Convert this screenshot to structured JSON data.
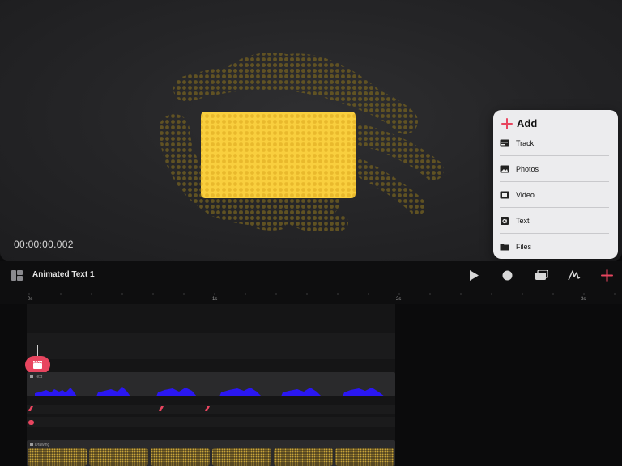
{
  "preview": {
    "timecode": "00:00:00.002"
  },
  "add_menu": {
    "title": "Add",
    "items": [
      {
        "label": "Track",
        "icon": "track-icon"
      },
      {
        "label": "Photos",
        "icon": "photos-icon"
      },
      {
        "label": "Video",
        "icon": "video-icon"
      },
      {
        "label": "Text",
        "icon": "text-icon"
      },
      {
        "label": "Files",
        "icon": "folder-icon"
      }
    ]
  },
  "toolbar": {
    "project_title": "Animated Text 1",
    "buttons": [
      "layout-icon",
      "play-icon",
      "record-icon",
      "layers-icon",
      "draw-icon",
      "add-icon"
    ]
  },
  "timeline": {
    "ruler_labels": [
      "0s",
      "1s",
      "2s",
      "3s"
    ],
    "tracks": [
      {
        "label": "Text"
      },
      {
        "label": "Drawing"
      }
    ]
  },
  "colors": {
    "accent": "#e8455f",
    "highlight_fill": "#f7c93c",
    "waveform": "#2a17f2",
    "drawing_clip": "#c7a33a"
  }
}
